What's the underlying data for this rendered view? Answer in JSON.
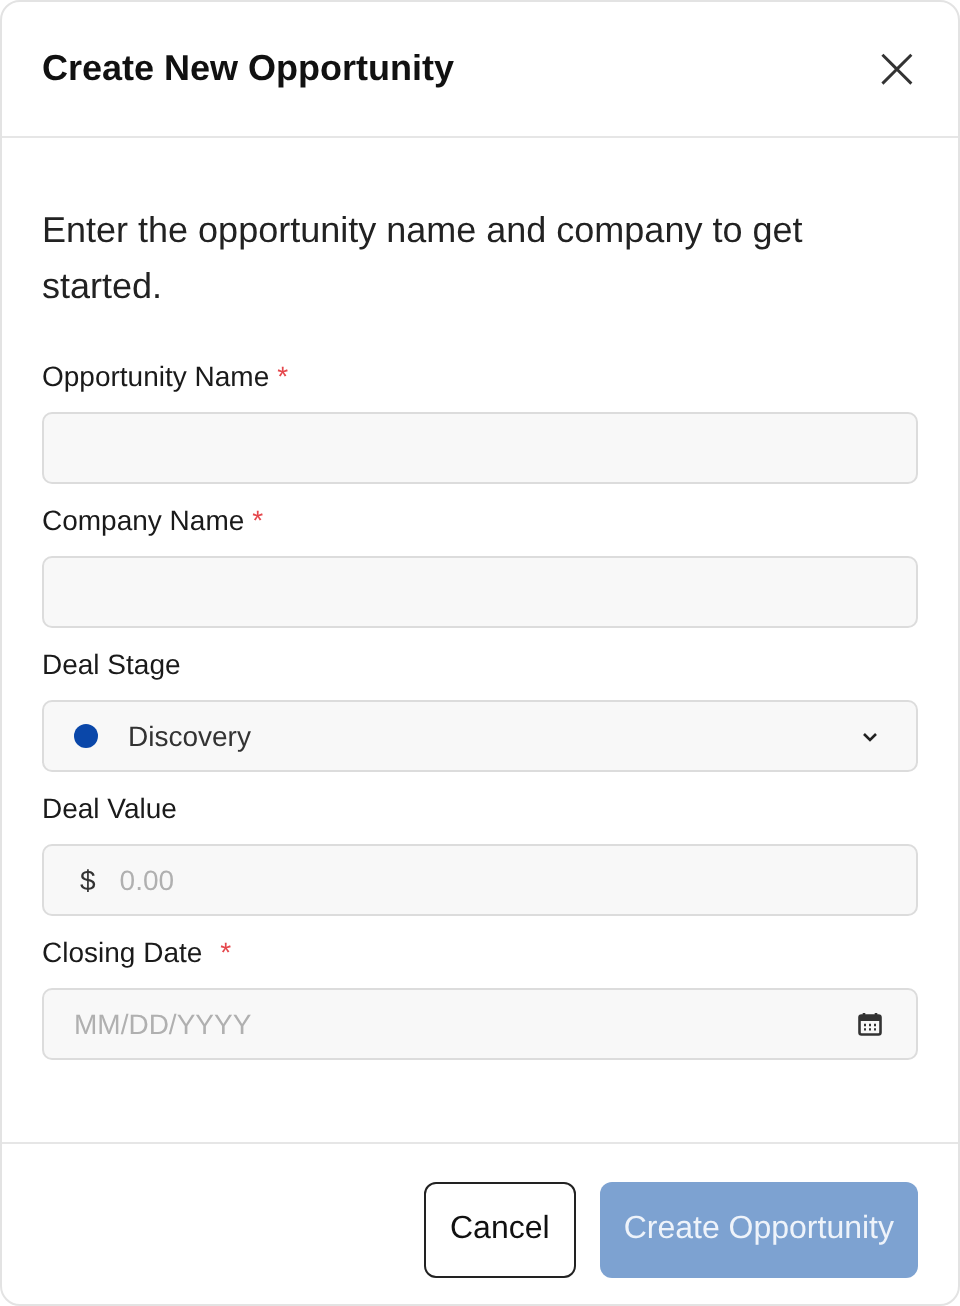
{
  "dialog": {
    "title": "Create New Opportunity",
    "close": "×"
  },
  "intro": "Enter the opportunity name and company to get started.",
  "fields": [
    {
      "kind": "text",
      "label": "Opportunity Name",
      "required_mark": "*"
    },
    {
      "kind": "text",
      "label": "Company Name",
      "required_mark": "*"
    },
    {
      "kind": "select",
      "label": "Deal Stage",
      "value": "Discovery",
      "color": "#0a47a9"
    },
    {
      "kind": "currency",
      "label": "Deal Value",
      "prefix": "$",
      "placeholder": "0.00"
    },
    {
      "kind": "date",
      "label": "Closing Date",
      "required_mark": "*",
      "placeholder": "MM/DD/YYYY"
    }
  ],
  "buttons": [
    {
      "kind": "secondary",
      "label": "Cancel",
      "disabled": false
    },
    {
      "kind": "primary",
      "label": "Create Opportunity",
      "disabled": true
    }
  ]
}
